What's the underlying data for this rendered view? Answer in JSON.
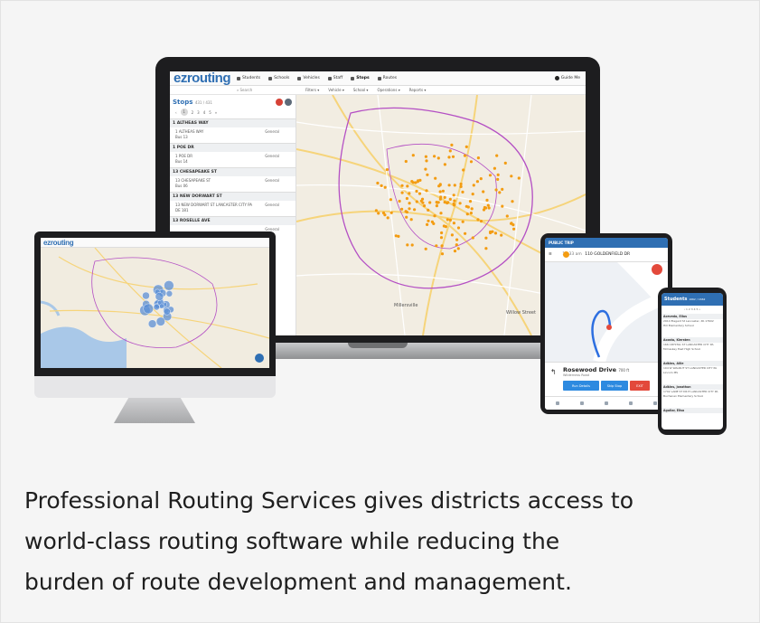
{
  "laptop": {
    "app": {
      "logo": "ezrouting",
      "nav": [
        "Students",
        "Schools",
        "Vehicles",
        "Staff",
        "Stops",
        "Routes"
      ],
      "active_nav": "Stops",
      "guide_label": "Guide Me",
      "search_placeholder": "Search",
      "filters": [
        "Filters ▾",
        "Vehicle ▾",
        "School ▾",
        "Operations ▾",
        "Reports ▾"
      ]
    },
    "stops_panel": {
      "title": "Stops",
      "count": "431 / 431",
      "pager": [
        "1",
        "2",
        "3",
        "4",
        "5"
      ],
      "stops": [
        {
          "name": "1 ALTHEAS WAY",
          "line1": "1 ALTHEAS WAY",
          "line2": "Bus 13",
          "type": "General"
        },
        {
          "name": "1 POE DR",
          "line1": "1 POE DR",
          "line2": "Bus 14",
          "type": "General"
        },
        {
          "name": "13 CHESAPEAKE ST",
          "line1": "13 CHESAPEAKE ST",
          "line2": "Bus 06",
          "type": "General"
        },
        {
          "name": "13 NEW DORWART ST",
          "line1": "13 NEW DORWART ST LANCASTER CITY PA",
          "line2": "DE 181",
          "type": "General"
        },
        {
          "name": "13 ROSELLE AVE",
          "line1": "",
          "line2": "",
          "type": "General"
        }
      ]
    },
    "map_labels": [
      "Millersville",
      "Willow Street"
    ]
  },
  "monitor": {
    "logo": "ezrouting"
  },
  "tablet": {
    "header": "PUBLIC TRIP",
    "time": "12:33 am",
    "address": "110 GOLDENFIELD DR",
    "street": "Rosewood Drive",
    "distance": "700 ft",
    "sub": "Wilderness Road",
    "buttons": [
      "Run Details",
      "Skip Stop",
      "EXIT"
    ]
  },
  "phone": {
    "title": "Students",
    "count": "1662 / 1662",
    "students": [
      {
        "name": "Acevedo, Elias",
        "address": "2914 Elegant St Lancaster, PA 17602",
        "school": "Hill Elementary School"
      },
      {
        "name": "Acosta, Kiersten",
        "address": "166 CRYSTAL ST LANCASTER CITY PA",
        "school": "McCaskey East High School"
      },
      {
        "name": "Adkins, Allie",
        "address": "104 W WALNUT ST LANCASTER CITY PA",
        "school": "Lincoln MS"
      },
      {
        "name": "Adkins, Jonathan",
        "address": "1702 LANE ST DR E LANCASTER CITY PA",
        "school": "Buchanan Elementary School"
      },
      {
        "name": "Aguilar, Elisa",
        "address": "",
        "school": ""
      }
    ]
  },
  "caption": {
    "line1": "Professional Routing Services gives districts access to",
    "line2": "world-class routing software while reducing the",
    "line3": "burden of route development and management."
  },
  "colors": {
    "brand": "#2f6fb3",
    "stop_marker": "#f39c12",
    "danger": "#e3493b",
    "boundary": "#b44fc4"
  }
}
